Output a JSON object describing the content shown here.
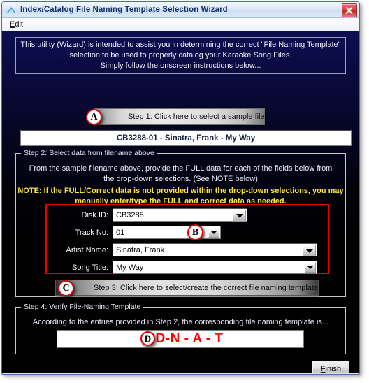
{
  "window": {
    "title": "Index/Catalog File Naming Template Selection Wizard",
    "icon": "triangle-app-icon",
    "close_icon": "close-icon"
  },
  "menubar": {
    "items": [
      {
        "label": "Edit",
        "mnemonic": "E",
        "rest": "dit"
      }
    ]
  },
  "intro": {
    "line1": "This utility (Wizard) is intended to assist you in determining the correct \"File Naming Template\"",
    "line2": "selection to be used to properly catalog your Karaoke Song Files.",
    "line3": "Simply follow the onscreen instructions below..."
  },
  "step1": {
    "button_label": "Step 1: Click here to select a sample file...",
    "callout": "A",
    "sample_filename": "CB3288-01 - Sinatra, Frank - My Way"
  },
  "step2": {
    "legend": "Step 2: Select data from filename above",
    "instruction_line1": "From the sample filename above, provide the FULL data for each of the fields below from",
    "instruction_line2": "the drop-down selections.  (See NOTE below)",
    "note_line1": "NOTE: If the FULL/Correct data is not provided within the drop-down selections, you may",
    "note_line2": "manually enter/type the FULL and correct data as needed.",
    "note_color": "#ffe33d",
    "highlight_color": "#e80000",
    "callout": "B",
    "fields": [
      {
        "label": "Disk ID:",
        "value": "CB3288",
        "name": "disk-id"
      },
      {
        "label": "Track No:",
        "value": "01",
        "name": "track-no"
      },
      {
        "label": "Artist Name:",
        "value": "Sinatra, Frank",
        "name": "artist-name"
      },
      {
        "label": "Song Title:",
        "value": "My Way",
        "name": "song-title"
      }
    ]
  },
  "step3": {
    "button_label": "Step 3: Click here to select/create the correct file naming template",
    "callout": "C"
  },
  "step4": {
    "legend": "Step 4: Verify File-Naming Template",
    "instruction": "According to the entries provided in Step 2,  the corresponding file naming template is...",
    "template": "D-N - A - T",
    "template_color": "#ff0000",
    "callout": "D"
  },
  "footer": {
    "finish_mnemonic": "F",
    "finish_rest": "inish"
  }
}
